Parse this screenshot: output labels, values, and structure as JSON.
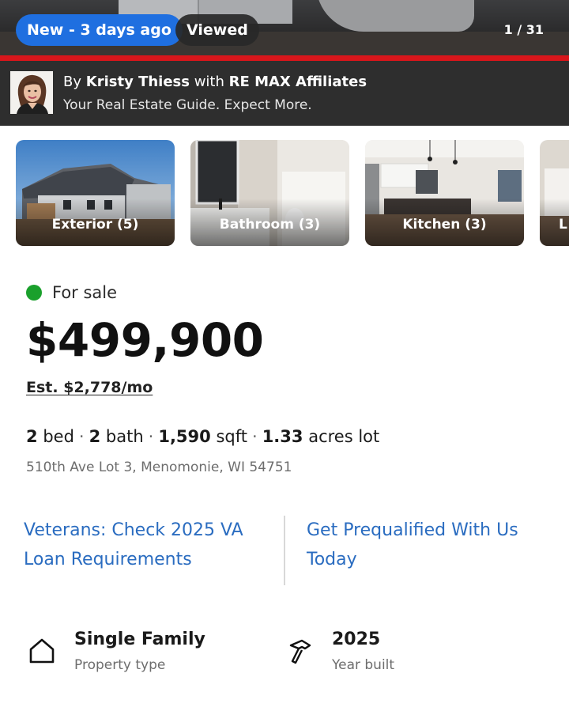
{
  "hero": {
    "badge_new": "New - 3 days ago",
    "badge_viewed": "Viewed",
    "photo_counter": "1 / 31",
    "accent_color": "#d8161b",
    "badge_color": "#1f6fe0"
  },
  "agent": {
    "by": "By",
    "name": "Kristy Thiess",
    "with": "with",
    "brokerage": "RE MAX Affiliates",
    "tagline": "Your Real Estate Guide. Expect More."
  },
  "photo_categories": [
    {
      "label": "Exterior (5)"
    },
    {
      "label": "Bathroom (3)"
    },
    {
      "label": "Kitchen (3)"
    },
    {
      "label": "L"
    }
  ],
  "listing": {
    "status": "For sale",
    "status_color": "#1aa02c",
    "price": "$499,900",
    "estimate": "Est. $2,778/mo",
    "beds": "2",
    "beds_label": "bed",
    "baths": "2",
    "baths_label": "bath",
    "sqft": "1,590",
    "sqft_label": "sqft",
    "lot": "1.33",
    "lot_label": "acres lot",
    "address": "510th Ave Lot 3, Menomonie, WI 54751"
  },
  "links": {
    "va": "Veterans: Check 2025 VA Loan Requirements",
    "prequal": "Get Prequalified With Us Today",
    "link_color": "#2a6cc0"
  },
  "facts": [
    {
      "icon": "house-icon",
      "value": "Single Family",
      "label": "Property type"
    },
    {
      "icon": "hammer-icon",
      "value": "2025",
      "label": "Year built"
    }
  ]
}
